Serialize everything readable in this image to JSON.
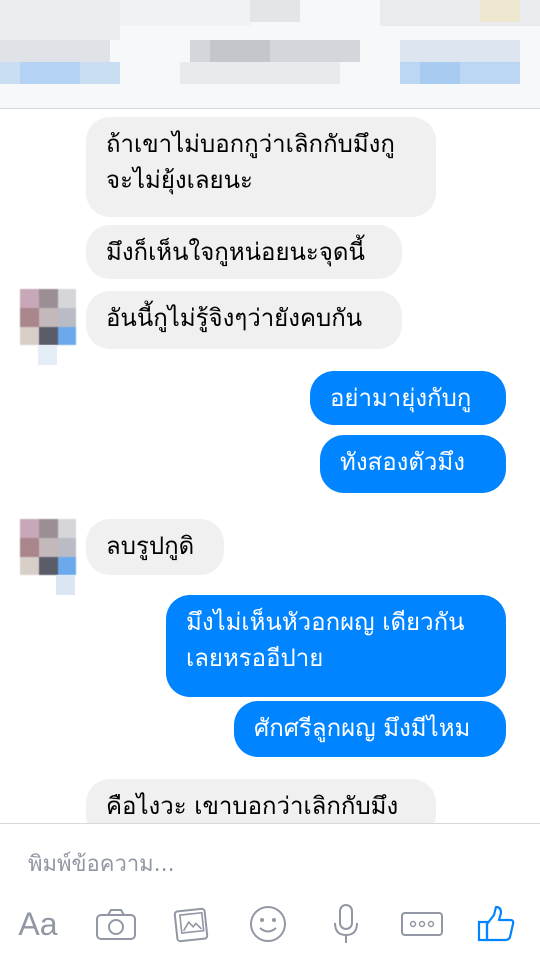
{
  "messages": [
    {
      "side": "received",
      "text": "ถ้าเขาไม่บอกกูว่าเลิกกับมึงกู\nจะไม่ยุ้งเลยนะ"
    },
    {
      "side": "received",
      "text": "มึงก็เห็นใจกูหน่อยนะจุดนี้"
    },
    {
      "side": "received",
      "text": "อันนี้กูไม่รู้จิงๆว่ายังคบกัน"
    },
    {
      "side": "sent",
      "text": "อย่ามายุ่งกับกู"
    },
    {
      "side": "sent",
      "text": "ทังสองตัวมึง"
    },
    {
      "side": "received",
      "text": "ลบรูปกูดิ"
    },
    {
      "side": "sent",
      "text": "มึงไม่เห็นหัวอกผญ เดียวกัน\nเลยหรออีปาย"
    },
    {
      "side": "sent",
      "text": "ศักศรีลูกผญ มึงมีไหม"
    },
    {
      "side": "received",
      "text": "คือไงวะ เขาบอกว่าเลิกกับมึง"
    }
  ],
  "composer": {
    "placeholder": "พิมพ์ข้อความ...",
    "aa_label": "Aa",
    "icons": [
      "camera-icon",
      "photo-icon",
      "emoji-icon",
      "microphone-icon",
      "more-icon",
      "thumbs-up-icon"
    ]
  },
  "colors": {
    "sent_bubble": "#0084ff",
    "received_bubble": "#f1f0f0",
    "icon_gray": "#9197a3",
    "like_blue": "#0084ff"
  }
}
